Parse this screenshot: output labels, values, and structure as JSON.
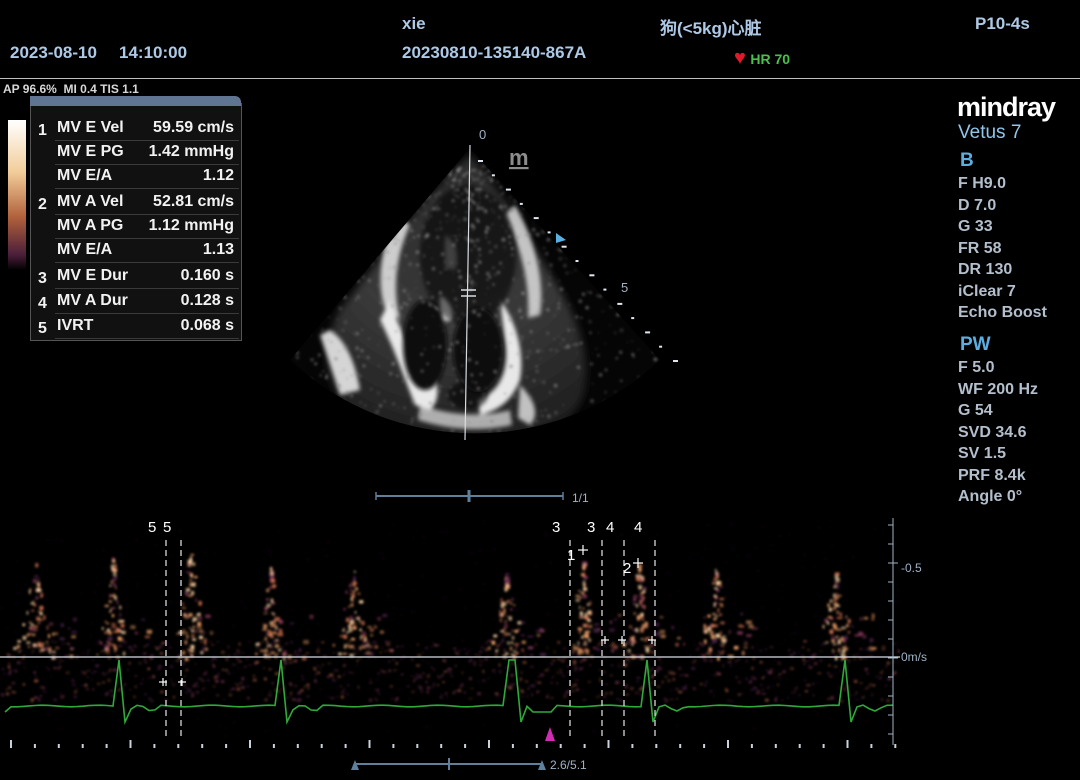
{
  "header": {
    "date": "2023-08-10",
    "time": "14:10:00",
    "patient_name": "xie",
    "exam_id": "20230810-135140-867A",
    "exam_type": "狗(<5kg)心脏",
    "probe": "P10-4s",
    "hr_label": "HR 70",
    "heart_icon": "heart-icon"
  },
  "acoustics": "AP 96.6%  MI 0.4 TIS 1.1",
  "measurements": [
    {
      "index": "1",
      "label": "MV E Vel",
      "value": "59.59 cm/s"
    },
    {
      "index": "",
      "label": "MV E PG",
      "value": "1.42 mmHg"
    },
    {
      "index": "",
      "label": "MV E/A",
      "value": "1.12"
    },
    {
      "index": "2",
      "label": "MV A Vel",
      "value": "52.81 cm/s"
    },
    {
      "index": "",
      "label": "MV A PG",
      "value": "1.12 mmHg"
    },
    {
      "index": "",
      "label": "MV E/A",
      "value": "1.13"
    },
    {
      "index": "3",
      "label": "MV E Dur",
      "value": "0.160 s"
    },
    {
      "index": "4",
      "label": "MV A Dur",
      "value": "0.128 s"
    },
    {
      "index": "5",
      "label": "IVRT",
      "value": "0.068 s"
    }
  ],
  "brand": {
    "logo": "mindray",
    "model": "Vetus 7"
  },
  "b_mode": {
    "title": "B",
    "params": [
      "F H9.0",
      "D 7.0",
      "G 33",
      "FR 58",
      "DR 130",
      "iClear 7",
      "Echo Boost"
    ]
  },
  "pw_mode": {
    "title": "PW",
    "params": [
      "F 5.0",
      "WF 200 Hz",
      "G 54",
      "SVD 34.6",
      "SV 1.5",
      "PRF 8.4k",
      "Angle  0°"
    ]
  },
  "image": {
    "depth_top": "0",
    "depth_mid": "5",
    "frame_counter": "1/1",
    "logo_mark": "m"
  },
  "doppler": {
    "scale_pos": "-0.5",
    "scale_zero": "0m/s",
    "time_counter": "2.6/5.1",
    "cursor_labels": [
      "5",
      "5",
      "3",
      "3",
      "4",
      "4"
    ],
    "point_labels": [
      "1",
      "2"
    ]
  },
  "colors": {
    "header_text": "#aec9e6",
    "accent_blue": "#5aaee0",
    "ecg": "#2faa3a",
    "heart": "#e0192b",
    "hr_text": "#49c24a"
  }
}
